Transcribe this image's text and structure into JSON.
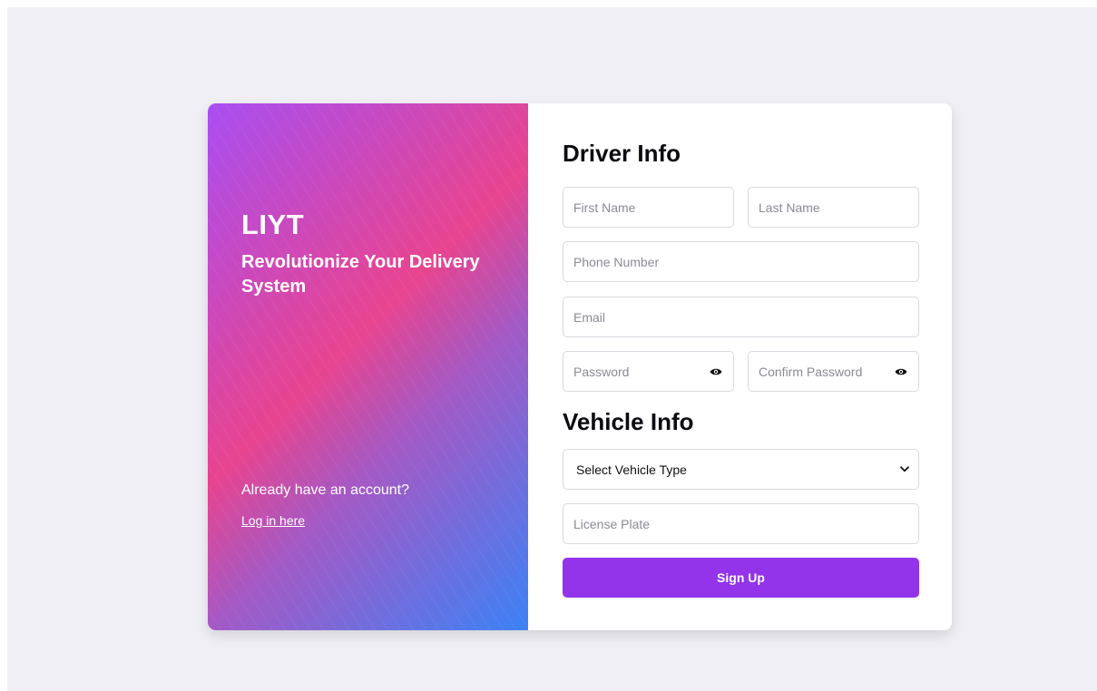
{
  "hero": {
    "brand": "LIYT",
    "tagline": "Revolutionize Your Delivery System",
    "account_question": "Already have an account?",
    "login_link": "Log in here"
  },
  "driver_info": {
    "title": "Driver Info",
    "first_name_placeholder": "First Name",
    "last_name_placeholder": "Last Name",
    "phone_placeholder": "Phone Number",
    "email_placeholder": "Email",
    "password_placeholder": "Password",
    "confirm_password_placeholder": "Confirm Password",
    "password_toggle_icon": "eye-icon"
  },
  "vehicle_info": {
    "title": "Vehicle Info",
    "vehicle_type_selected": "Select Vehicle Type",
    "license_plate_placeholder": "License Plate"
  },
  "signup_label": "Sign Up",
  "colors": {
    "background": "#f0eff5",
    "gradient_start": "#a84ef2",
    "gradient_mid": "#e8448f",
    "gradient_end": "#3b82f6",
    "accent_button": "#9333ea"
  }
}
